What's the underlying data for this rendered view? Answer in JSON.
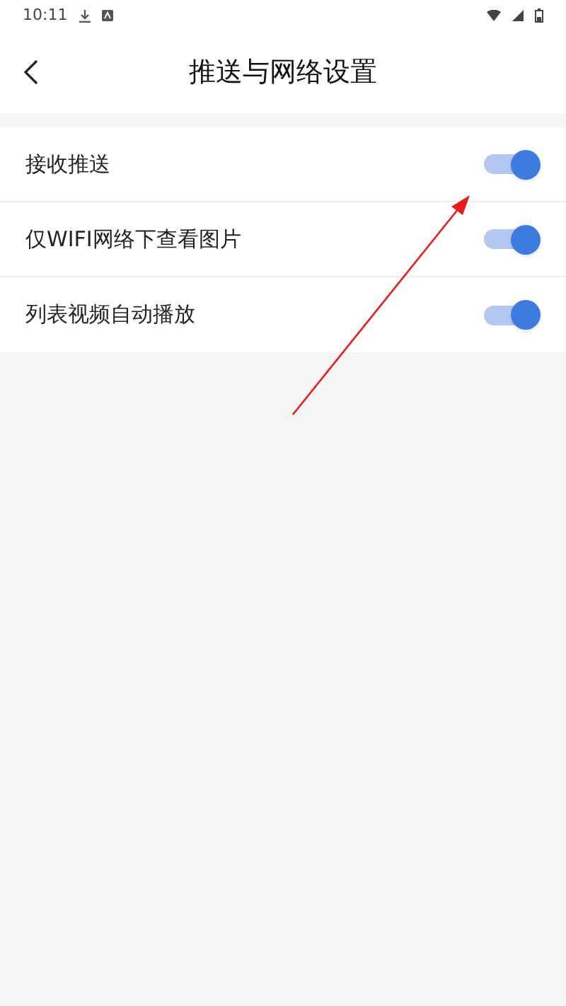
{
  "status_bar": {
    "time": "10:11"
  },
  "header": {
    "title": "推送与网络设置"
  },
  "settings": [
    {
      "label": "接收推送",
      "on": true
    },
    {
      "label": "仅WIFI网络下查看图片",
      "on": true
    },
    {
      "label": "列表视频自动播放",
      "on": true
    }
  ]
}
